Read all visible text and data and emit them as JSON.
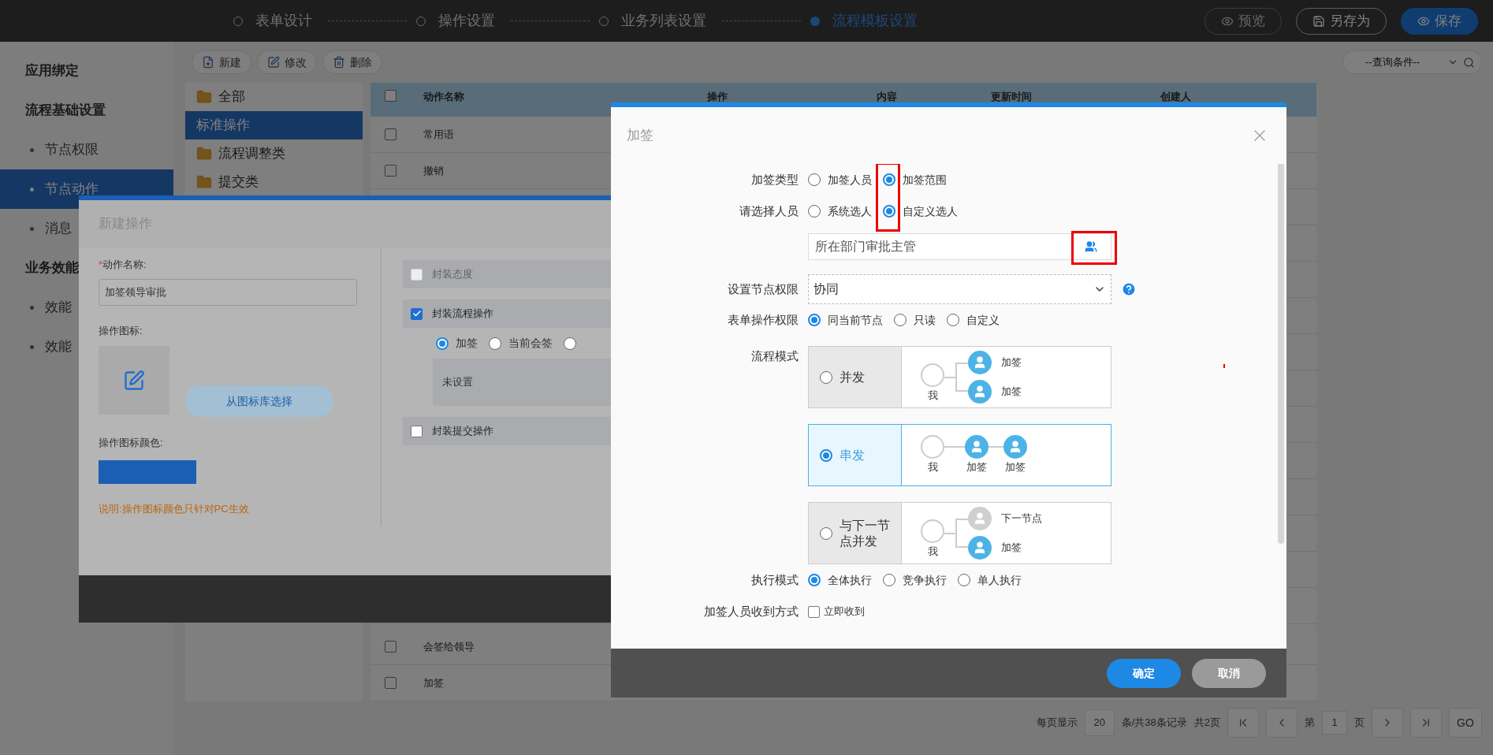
{
  "top_bar": {
    "steps": [
      {
        "label": "表单设计",
        "selected": false
      },
      {
        "label": "操作设置",
        "selected": false
      },
      {
        "label": "业务列表设置",
        "selected": false
      },
      {
        "label": "流程模板设置",
        "selected": true
      }
    ],
    "buttons": [
      {
        "label": "预览",
        "kind": "outline",
        "disabled": true
      },
      {
        "label": "另存为",
        "kind": "outline",
        "disabled": false
      },
      {
        "label": "保存",
        "kind": "primary",
        "disabled": false
      }
    ]
  },
  "sidebar": {
    "groups": [
      {
        "title": "应用绑定"
      },
      {
        "title": "流程基础设置",
        "items": [
          {
            "label": "节点权限",
            "selected": false
          },
          {
            "label": "节点动作",
            "selected": true
          },
          {
            "label": "消息",
            "selected": false
          }
        ]
      },
      {
        "title": "业务效能",
        "items": [
          {
            "label": "效能",
            "selected": false
          },
          {
            "label": "效能",
            "selected": false
          }
        ]
      }
    ]
  },
  "toolbar": {
    "buttons": [
      "新建",
      "修改",
      "删除"
    ],
    "query": {
      "placeholder": "--查询条件--"
    }
  },
  "folders": [
    {
      "label": "全部",
      "kind": "folder",
      "selected": false
    },
    {
      "label": "标准操作",
      "kind": "group",
      "selected": true
    },
    {
      "label": "流程调整类",
      "kind": "folder",
      "selected": false
    },
    {
      "label": "提交类",
      "kind": "folder",
      "selected": false
    }
  ],
  "table": {
    "all_checked": false,
    "columns": [
      "动作名称",
      "操作",
      "内容",
      "更新时间",
      "创建人"
    ],
    "rows": [
      {
        "name": "常用语",
        "checked": false
      },
      {
        "name": "撤销",
        "checked": false
      }
    ],
    "lower_rows": [
      {
        "name": "会签给领导",
        "checked": false
      },
      {
        "name": "加签",
        "checked": false
      }
    ]
  },
  "pagination": {
    "per_page_label": "每页显示",
    "per_page": "20",
    "summary": "条/共38条记录",
    "pages": "共2页",
    "page_prefix": "第",
    "page": "1",
    "page_suffix": "页",
    "go": "GO"
  },
  "new_dialog": {
    "title": "新建操作",
    "required_mark": "*",
    "name_label": "动作名称:",
    "name_value": "加签领导审批",
    "icon_label": "操作图标:",
    "pick_button": "从图标库选择",
    "color_label": "操作图标颜色:",
    "color": "#1a5fb4",
    "note": "说明:操作图标颜色只针对PC生效",
    "options": [
      {
        "label": "封装态度",
        "checked": false,
        "disabled": true
      },
      {
        "label": "封装流程操作",
        "checked": true,
        "disabled": false,
        "radios": [
          {
            "label": "加签",
            "selected": true
          },
          {
            "label": "当前会签",
            "selected": false
          },
          {
            "selected": false
          }
        ],
        "value": "未设置"
      },
      {
        "label": "封装提交操作",
        "checked": false,
        "disabled": false
      }
    ]
  },
  "dialog": {
    "title": "加签",
    "fields": [
      {
        "kind": "radio",
        "label": "加签类型",
        "options": [
          {
            "label": "加签人员",
            "selected": false
          },
          {
            "label": "加签范围",
            "selected": true
          }
        ]
      },
      {
        "kind": "radio",
        "label": "请选择人员",
        "options": [
          {
            "label": "系统选人",
            "selected": false
          },
          {
            "label": "自定义选人",
            "selected": true
          }
        ]
      },
      {
        "kind": "picker",
        "value": "所在部门审批主管"
      },
      {
        "kind": "select",
        "label": "设置节点权限",
        "value": "协同"
      },
      {
        "kind": "radio",
        "label": "表单操作权限",
        "options": [
          {
            "label": "同当前节点",
            "selected": true
          },
          {
            "label": "只读",
            "selected": false
          },
          {
            "label": "自定义",
            "selected": false
          }
        ]
      },
      {
        "kind": "mode",
        "label": "流程模式",
        "modes": [
          {
            "label": "并发",
            "selected": false,
            "kind": "parallel",
            "me": "我",
            "nodes": [
              {
                "label": "加签",
                "kind": "added"
              },
              {
                "label": "加签",
                "kind": "added"
              }
            ]
          },
          {
            "label": "串发",
            "selected": true,
            "kind": "serial",
            "me": "我",
            "nodes": [
              {
                "label": "加签",
                "kind": "added"
              },
              {
                "label": "加签",
                "kind": "added"
              }
            ]
          },
          {
            "label": "与下一节点并发",
            "selected": false,
            "kind": "parallel",
            "me": "我",
            "nodes": [
              {
                "label": "下一节点",
                "kind": "next"
              },
              {
                "label": "加签",
                "kind": "added"
              }
            ]
          }
        ]
      },
      {
        "kind": "radio",
        "label": "执行模式",
        "options": [
          {
            "label": "全体执行",
            "selected": true
          },
          {
            "label": "竞争执行",
            "selected": false
          },
          {
            "label": "单人执行",
            "selected": false
          }
        ]
      },
      {
        "kind": "checkbox",
        "label": "加签人员收到方式",
        "options": [
          {
            "label": "立即收到",
            "checked": false
          }
        ]
      }
    ],
    "buttons": [
      {
        "label": "确定",
        "kind": "primary"
      },
      {
        "label": "取消",
        "kind": "secondary"
      }
    ]
  }
}
